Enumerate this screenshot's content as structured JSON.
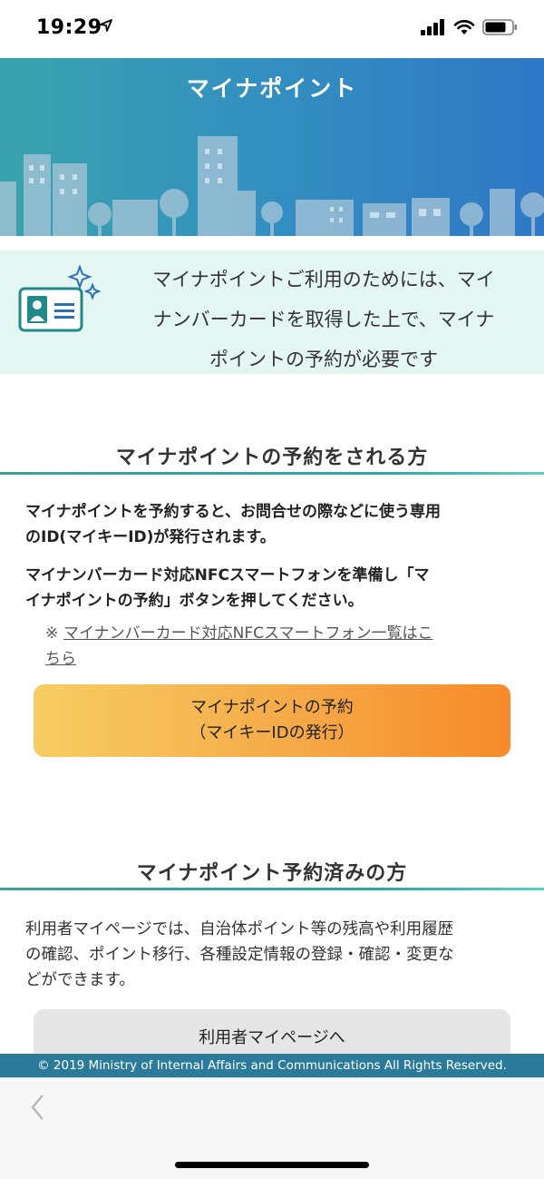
{
  "status_bar": {
    "time": "19:29",
    "location_icon": "location-arrow-icon",
    "signal_icon": "cellular-signal-icon",
    "wifi_icon": "wifi-icon",
    "battery_icon": "battery-icon"
  },
  "header": {
    "title": "マイナポイント"
  },
  "info": {
    "icon": "id-card-icon",
    "line1": "マイナポイントご利用のためには、マイ",
    "line2": "ナンバーカードを取得した上で、マイナ",
    "line3": "ポイントの予約が必要です"
  },
  "reserve_section": {
    "heading": "マイナポイントの予約をされる方",
    "para1_line1": "マイナポイントを予約すると、お問合せの際などに使う専用",
    "para1_line2": "のID(マイキーID)が発行されます。",
    "para2_line1": "マイナンバーカード対応NFCスマートフォンを準備し「マ",
    "para2_line2": "イナポイントの予約」ボタンを押してください。",
    "note_mark": "※",
    "note_link_line1": "マイナンバーカード対応NFCスマートフォン一覧はこ",
    "note_link_line2": "ちら",
    "button_line1": "マイナポイントの予約",
    "button_line2": "（マイキーIDの発行）"
  },
  "reserved_section": {
    "heading": "マイナポイント予約済みの方",
    "text_line1": "利用者マイページでは、自治体ポイント等の残高や利用履歴",
    "text_line2": "の確認、ポイント移行、各種設定情報の登録・確認・変更な",
    "text_line3": "どができます。",
    "button_label": "利用者マイページへ"
  },
  "footer": {
    "copyright": "© 2019 Ministry of Internal Affairs and Communications All Rights Reserved."
  },
  "browser": {
    "back_icon": "chevron-left-icon"
  },
  "colors": {
    "header_gradient_start": "#3aa3ad",
    "header_gradient_end": "#2f78c6",
    "info_bg": "#e4f6f2",
    "accent_teal": "#2aa9a2",
    "primary_btn_start": "#f6ce63",
    "primary_btn_end": "#f78a2a",
    "secondary_btn": "#e5e5e5",
    "footer_bg": "#2b7a9a"
  }
}
